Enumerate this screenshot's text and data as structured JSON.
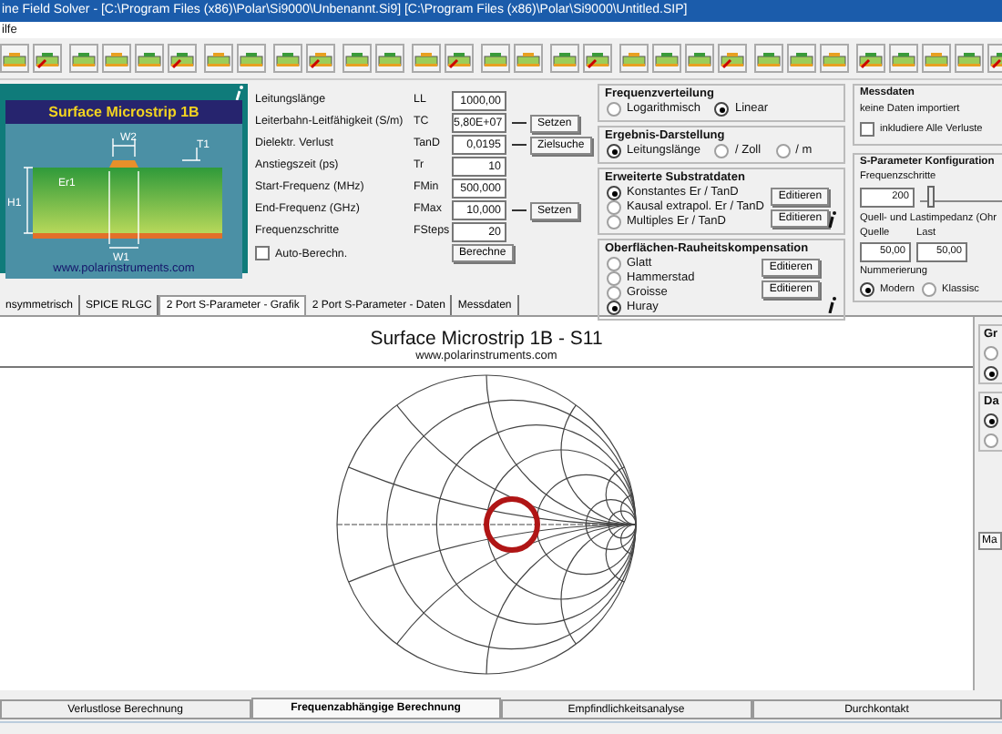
{
  "window": {
    "title": "ine Field Solver - [C:\\Program Files (x86)\\Polar\\Si9000\\Unbenannt.Si9]  [C:\\Program Files (x86)\\Polar\\Si9000\\Untitled.SIP]"
  },
  "menu": [
    "ilfe"
  ],
  "structure": {
    "title": "Surface Microstrip 1B",
    "labels": [
      "W2",
      "T1",
      "H1",
      "Er1",
      "W1"
    ],
    "url": "www.polarinstruments.com"
  },
  "parameters": [
    {
      "label": "Leitungslänge",
      "symbol": "LL",
      "value": "1000,00"
    },
    {
      "label": "Leiterbahn-Leitfähigkeit (S/m)",
      "symbol": "TC",
      "value": "5,80E+07",
      "button": "Setzen"
    },
    {
      "label": "Dielektr. Verlust",
      "symbol": "TanD",
      "value": "0,0195",
      "button": "Zielsuche"
    },
    {
      "label": "Anstiegszeit (ps)",
      "symbol": "Tr",
      "value": "10"
    },
    {
      "label": "Start-Frequenz (MHz)",
      "symbol": "FMin",
      "value": "500,000"
    },
    {
      "label": "End-Frequenz (GHz)",
      "symbol": "FMax",
      "value": "10,000",
      "button": "Setzen"
    },
    {
      "label": "Frequenzschritte",
      "symbol": "FSteps",
      "value": "20"
    }
  ],
  "auto_calc": {
    "label": "Auto-Berechn.",
    "checked": false
  },
  "calc_button": "Berechne",
  "groups": [
    {
      "title": "Frequenzverteilung",
      "options": [
        {
          "label": "Logarithmisch",
          "selected": false
        },
        {
          "label": "Linear",
          "selected": true
        }
      ]
    },
    {
      "title": "Ergebnis-Darstellung",
      "options": [
        {
          "label": "Leitungslänge",
          "selected": true
        },
        {
          "label": "/ Zoll",
          "selected": false
        },
        {
          "label": "/ m",
          "selected": false
        }
      ]
    },
    {
      "title": "Erweiterte Substratdaten",
      "options": [
        {
          "label": "Konstantes Er / TanD",
          "selected": true
        },
        {
          "label": "Kausal extrapol.  Er / TanD",
          "selected": false
        },
        {
          "label": "Multiples Er / TanD",
          "selected": false
        }
      ],
      "buttons": [
        "Editieren",
        "Editieren"
      ]
    },
    {
      "title": "Oberflächen-Rauheitskompensation",
      "options": [
        {
          "label": "Glatt",
          "selected": false
        },
        {
          "label": "Hammerstad",
          "selected": false
        },
        {
          "label": "Groisse",
          "selected": false
        },
        {
          "label": "Huray",
          "selected": true
        }
      ],
      "buttons": [
        "Editieren",
        "Editieren"
      ]
    }
  ],
  "measurement": {
    "title": "Messdaten",
    "status": "keine Daten importiert",
    "include_losses": {
      "label": "inkludiere Alle Verluste",
      "checked": false
    }
  },
  "sparam_config": {
    "title": "S-Parameter Konfiguration",
    "steps_label": "Frequenzschritte",
    "steps": "200",
    "slider": {
      "level": 0.08
    },
    "impedance_label": "Quell- und Lastimpedanz (Ohr",
    "source_label": "Quelle",
    "source": "50,00",
    "load_label": "Last",
    "load": "50,00",
    "numbering_label": "Nummerierung",
    "numbering": [
      {
        "label": "Modern",
        "selected": true
      },
      {
        "label": "Klassisc",
        "selected": false
      }
    ]
  },
  "tabs": [
    {
      "label": "nsymmetrisch",
      "selected": false
    },
    {
      "label": "SPICE RLGC",
      "selected": false
    },
    {
      "label": "2 Port S-Parameter - Grafik",
      "selected": true
    },
    {
      "label": "2 Port S-Parameter - Daten",
      "selected": false
    },
    {
      "label": "Messdaten",
      "selected": false
    }
  ],
  "chart": {
    "title": "Surface Microstrip 1B - S11",
    "subtitle": "www.polarinstruments.com"
  },
  "side": {
    "groups": [
      {
        "title": "Gr",
        "options": [
          {
            "selected": false
          },
          {
            "selected": true
          }
        ]
      },
      {
        "title": "Da",
        "options": [
          {
            "selected": true
          },
          {
            "selected": false
          }
        ]
      }
    ],
    "button": "Ma"
  },
  "bottom_tabs": [
    {
      "label": "Verlustlose Berechnung",
      "selected": false
    },
    {
      "label": "Frequenzabhängige Berechnung",
      "selected": true
    },
    {
      "label": "Empfindlichkeitsanalyse",
      "selected": false
    },
    {
      "label": "Durchkontakt",
      "selected": false
    }
  ]
}
